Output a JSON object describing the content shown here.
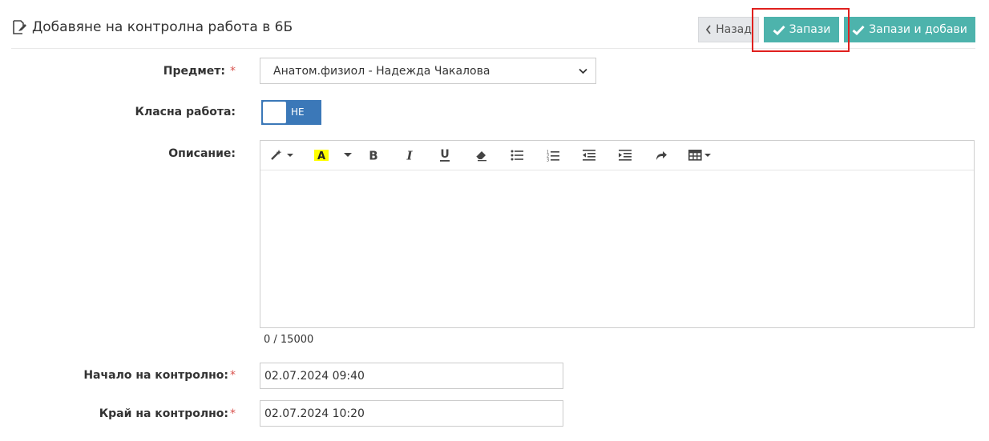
{
  "page": {
    "title": "Добавяне на контролна работа в 6Б",
    "title_icon": "edit-document-icon"
  },
  "actions": {
    "back_label": "Назад",
    "save_label": "Запази",
    "save_add_label": "Запази и добави"
  },
  "form": {
    "subject_label": "Предмет:",
    "subject_value": "Анатом.физиол - Надежда Чакалова",
    "class_work_label": "Класна работа:",
    "class_work_toggle": "НЕ",
    "description_label": "Описание:",
    "description_counter": "0 / 15000",
    "start_label": "Начало на контролно:",
    "start_value": "02.07.2024 09:40",
    "end_label": "Край на контролно:",
    "end_value": "02.07.2024 10:20",
    "required_mark": "*"
  },
  "toolbar_icons": [
    "magic-wand-icon",
    "highlight-color-icon",
    "color-dropdown-icon",
    "bold-icon",
    "italic-icon",
    "underline-icon",
    "eraser-icon",
    "bullet-list-icon",
    "numbered-list-icon",
    "outdent-icon",
    "indent-icon",
    "redo-icon",
    "table-icon"
  ],
  "colors": {
    "accent": "#4db3ac",
    "toggle": "#3b78b8",
    "required": "#d9534f",
    "highlight": "#ffff00",
    "callout": "#e0201e"
  }
}
